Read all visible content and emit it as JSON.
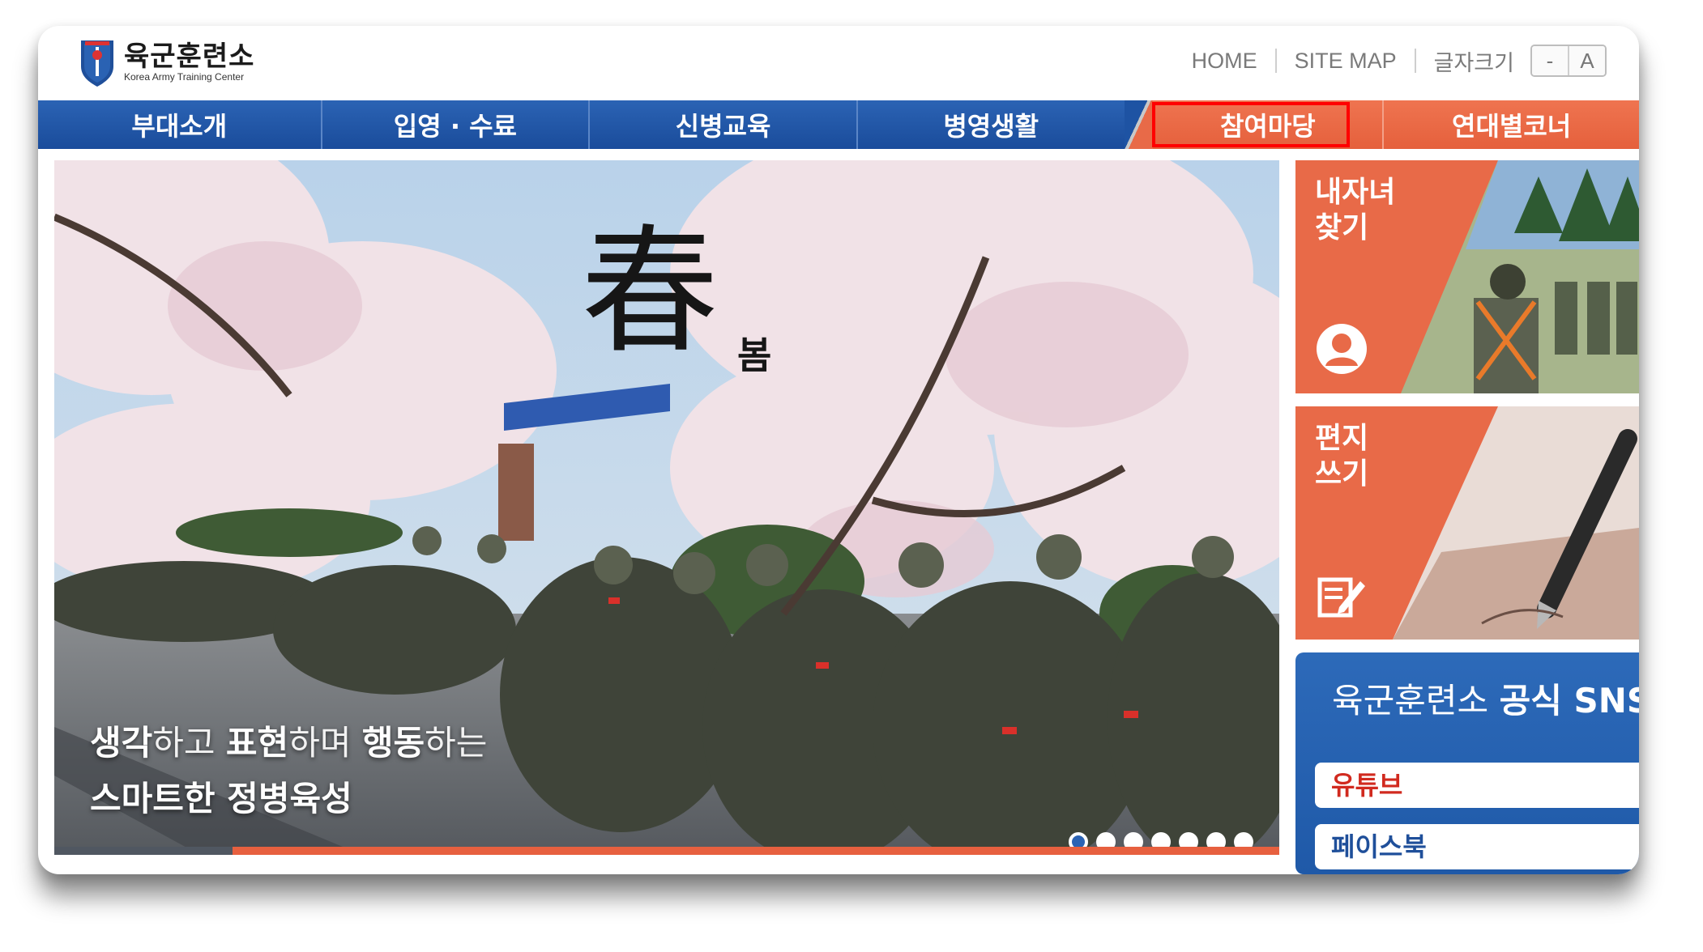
{
  "header": {
    "logo_ko": "육군훈련소",
    "logo_en": "Korea Army Training Center",
    "links": [
      "HOME",
      "SITE MAP",
      "글자크기"
    ],
    "font_size_minus": "-",
    "font_size_a": "A"
  },
  "nav": {
    "items": [
      "부대소개",
      "입영 · 수료",
      "신병교육",
      "병영생활",
      "참여마당",
      "연대별코너"
    ],
    "highlighted": "참여마당"
  },
  "hero": {
    "calligraphy_big": "春",
    "calligraphy_small": "봄",
    "slogan_w1": "생각",
    "slogan_w2": "하고 ",
    "slogan_w3": "표현",
    "slogan_w4": "하며 ",
    "slogan_w5": "행동",
    "slogan_w6": "하는",
    "slogan_line2": "스마트한 정병육성",
    "dot_count": 7,
    "active_dot": 1
  },
  "cards": {
    "find_child": "내자녀\n찾기",
    "find_child_l1": "내자녀",
    "find_child_l2": "찾기",
    "letter_l1": "편지",
    "letter_l2": "쓰기"
  },
  "sns": {
    "title_part1": "육군훈련소 ",
    "title_part2": "공식 SNS",
    "youtube": "유튜브",
    "facebook": "페이스북"
  },
  "colors": {
    "nav_blue": "#1f55a6",
    "nav_orange": "#e86a48",
    "highlight_box": "#ff0000",
    "sns_blue": "#2565b3"
  }
}
